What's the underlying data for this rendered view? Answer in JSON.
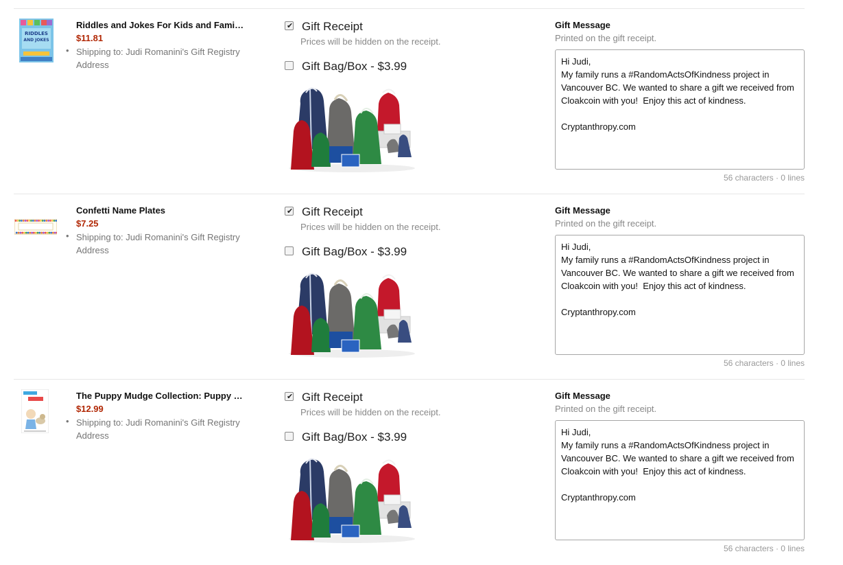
{
  "items": [
    {
      "title": "Riddles and Jokes For Kids and Fami…",
      "price": "$11.81",
      "shipping": "Shipping to:  Judi Romanini's Gift Registry Address",
      "thumb_type": "book-riddles",
      "thumb_text": [
        "RIDDLES",
        "AND JOKES"
      ],
      "gift_receipt_label": "Gift Receipt",
      "gift_receipt_checked": true,
      "gift_receipt_note": "Prices will be hidden on the receipt.",
      "gift_bag_label": "Gift Bag/Box - $3.99",
      "gift_bag_checked": false,
      "gift_message_title": "Gift Message",
      "gift_message_subtitle": "Printed on the gift receipt.",
      "gift_message_lines": [
        "Hi Judi,",
        "My family runs a #RandomActsOfKindness project in",
        "Vancouver BC. We wanted to share a gift we received from",
        "Cloakcoin with you!  Enjoy this act of kindness.",
        "",
        "Cryptanthropy.com"
      ],
      "counter": "56 characters · 0 lines"
    },
    {
      "title": "Confetti Name Plates",
      "price": "$7.25",
      "shipping": "Shipping to:  Judi Romanini's Gift Registry Address",
      "thumb_type": "name-plate",
      "thumb_text": [],
      "gift_receipt_label": "Gift Receipt",
      "gift_receipt_checked": true,
      "gift_receipt_note": "Prices will be hidden on the receipt.",
      "gift_bag_label": "Gift Bag/Box - $3.99",
      "gift_bag_checked": false,
      "gift_message_title": "Gift Message",
      "gift_message_subtitle": "Printed on the gift receipt.",
      "gift_message_lines": [
        "Hi Judi,",
        "My family runs a #RandomActsOfKindness project in",
        "Vancouver BC. We wanted to share a gift we received from",
        "Cloakcoin with you!  Enjoy this act of kindness.",
        "",
        "Cryptanthropy.com"
      ],
      "counter": "56 characters · 0 lines"
    },
    {
      "title": "The Puppy Mudge Collection: Puppy …",
      "price": "$12.99",
      "shipping": "Shipping to:  Judi Romanini's Gift Registry Address",
      "thumb_type": "book-puppy",
      "thumb_text": [],
      "gift_receipt_label": "Gift Receipt",
      "gift_receipt_checked": true,
      "gift_receipt_note": "Prices will be hidden on the receipt.",
      "gift_bag_label": "Gift Bag/Box - $3.99",
      "gift_bag_checked": false,
      "gift_message_title": "Gift Message",
      "gift_message_subtitle": "Printed on the gift receipt.",
      "gift_message_lines": [
        "Hi Judi,",
        "My family runs a #RandomActsOfKindness project in",
        "Vancouver BC. We wanted to share a gift we received from",
        "Cloakcoin with you!  Enjoy this act of kindness.",
        "",
        "Cryptanthropy.com"
      ],
      "counter": "56 characters · 0 lines"
    }
  ],
  "colors": {
    "price": "#b12704",
    "muted": "#767676",
    "divider": "#e7e7e7"
  }
}
